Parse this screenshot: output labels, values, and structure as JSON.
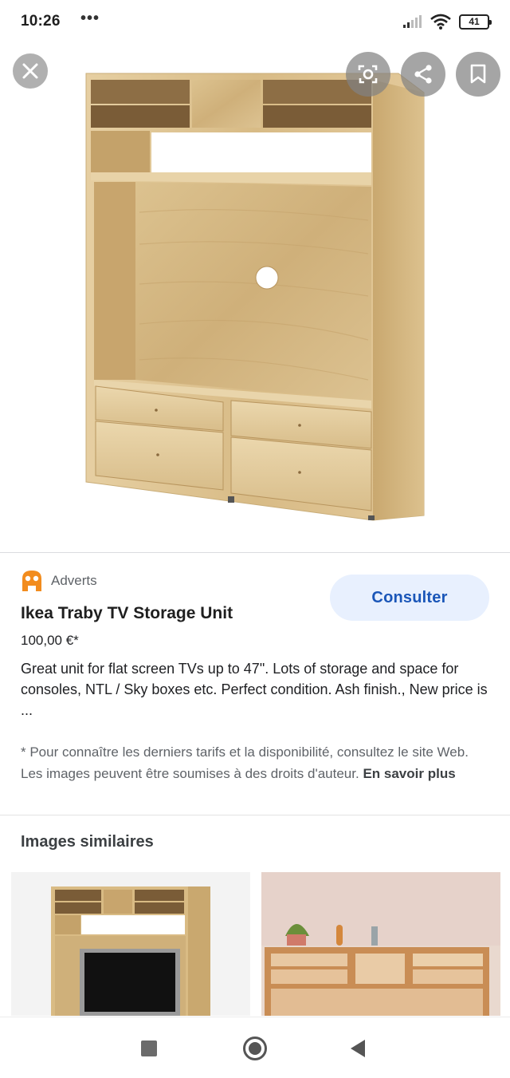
{
  "status_bar": {
    "time": "10:26",
    "dots": "•••",
    "battery": "41"
  },
  "hero": {
    "image_alt": "wood-tv-storage-unit-image"
  },
  "toolbar": {
    "close_icon": "close-icon",
    "lens_icon": "lens-icon",
    "share_icon": "share-icon",
    "save_icon": "bookmark-icon"
  },
  "result": {
    "source_name": "Adverts",
    "consult_label": "Consulter",
    "title": "Ikea Traby TV Storage Unit",
    "price": "100,00 €*",
    "description": "Great unit for flat screen TVs up to 47\". Lots of storage and space for consoles, NTL / Sky boxes etc. Perfect condition. Ash finish., New price is ...",
    "disclaimer": "* Pour connaître les derniers tarifs et la disponibilité, consultez le site Web. Les images peuvent être soumises à des droits d'auteur.",
    "learn_more": "En savoir plus"
  },
  "similar": {
    "title": "Images similaires"
  },
  "colors": {
    "accent": "#1a56b8",
    "button_bg": "#e8f0fe",
    "adverts_orange": "#f28c1e",
    "wood": "#d9bd8a"
  }
}
